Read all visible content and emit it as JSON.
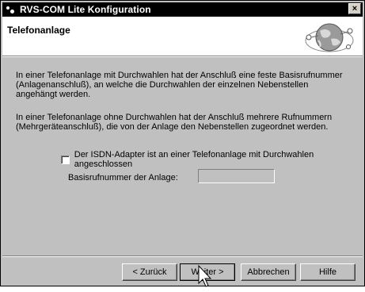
{
  "window": {
    "title": "RVS-COM Lite Konfiguration",
    "close_glyph": "×"
  },
  "header": {
    "title": "Telefonanlage",
    "graphic_icon": "globe-network-icon"
  },
  "main": {
    "paragraph_1": "In einer Telefonanlage mit Durchwahlen hat der Anschluß eine feste Basisrufnummer (Anlagenanschluß), an welche die Durchwahlen der einzelnen Nebenstellen angehängt werden.",
    "paragraph_2": "In einer Telefonanlage ohne Durchwahlen hat der Anschluß mehrere Rufnummern (Mehrgeräteanschluß), die von der Anlage den Nebenstellen zugeordnet werden.",
    "checkbox_label": "Der ISDN-Adapter ist an einer Telefonanlage mit Durchwahlen angeschlossen",
    "checkbox_checked": false,
    "basis_label": "Basisrufnummer der Anlage:",
    "basis_value": ""
  },
  "buttons": {
    "back": "< Zurück",
    "next": "Weiter >",
    "cancel": "Abbrechen",
    "help": "Hilfe"
  },
  "colors": {
    "face": "#c0c0c0",
    "titlebar": "#000000",
    "header_bg": "#ffffff"
  }
}
